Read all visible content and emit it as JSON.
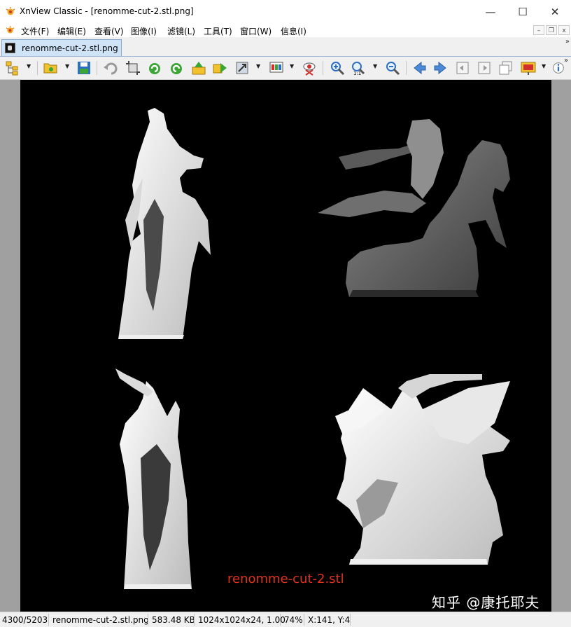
{
  "window": {
    "title": "XnView Classic - [renomme-cut-2.stl.png]",
    "minimize_symbol": "—",
    "maximize_symbol": "☐",
    "close_symbol": "✕"
  },
  "menu": {
    "items": [
      "文件(F)",
      "编辑(E)",
      "查看(V)",
      "图像(I)",
      "滤镜(L)",
      "工具(T)",
      "窗口(W)",
      "信息(I)"
    ],
    "mdi_minimize": "–",
    "mdi_restore": "❐",
    "mdi_close": "x"
  },
  "tab": {
    "label": "renomme-cut-2.stl.png",
    "overflow_symbol": "»"
  },
  "toolbar": {
    "icons": [
      "browser-tree-icon",
      "open-folder-icon",
      "save-icon",
      "undo-icon",
      "crop-icon",
      "rotate-left-icon",
      "rotate-right-icon",
      "flip-up-icon",
      "flip-right-icon",
      "resize-icon",
      "color-adjust-icon",
      "red-eye-icon",
      "zoom-in-icon",
      "zoom-1to1-icon",
      "zoom-out-icon",
      "prev-arrow-icon",
      "next-arrow-icon",
      "first-page-icon",
      "last-page-icon",
      "multipage-icon",
      "slideshow-icon",
      "info-icon"
    ],
    "colors": {
      "green": "#3aa635",
      "blue": "#2d6fc4",
      "yellow": "#f2c12e",
      "red": "#d2302c"
    }
  },
  "image": {
    "caption": "renomme-cut-2.stl",
    "caption_color": "#e0321e",
    "watermark": "知乎 @康托耶夫",
    "background": "#000000",
    "description_icons": [
      "statue-front-view",
      "statue-right-view",
      "statue-back-view",
      "statue-left-view"
    ]
  },
  "status": {
    "index": "4300/5203",
    "filename": "renomme-cut-2.stl.png",
    "filesize": "583.48 KB",
    "dimensions": "1024x1024x24, 1.00",
    "zoom": "74%",
    "coords": "X:141, Y:4"
  }
}
